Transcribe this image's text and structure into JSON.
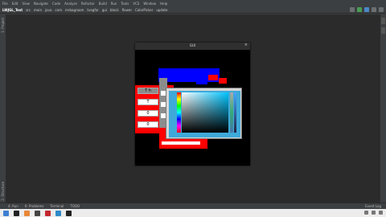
{
  "menubar": {
    "items": [
      "File",
      "Edit",
      "View",
      "Navigate",
      "Code",
      "Analyze",
      "Refactor",
      "Build",
      "Run",
      "Tools",
      "VCS",
      "Window",
      "Help"
    ]
  },
  "toolbar": {
    "breadcrumbs": [
      "LWJGL_Test",
      "src",
      "main",
      "java",
      "com",
      "mrbagroom",
      "tvegfor",
      "gui",
      "block",
      "flower",
      "ColorPicker",
      "update"
    ]
  },
  "left_strip": {
    "top_label": "1: Project",
    "bottom_label": "2: Structure"
  },
  "bottom_bar": {
    "items": [
      "4: Run",
      "6: Problems",
      "Terminal",
      "TODO"
    ],
    "event_log": "Event Log"
  },
  "app_window": {
    "title": "GUI",
    "close": "×"
  },
  "form": {
    "labels": [
      "T  h",
      "T",
      "0",
      "0"
    ]
  },
  "colors": {
    "window_bg": "#000000",
    "panel_blue": "#0000ff",
    "panel_red": "#ff0000",
    "picker_frame": "#3ea9d9"
  }
}
